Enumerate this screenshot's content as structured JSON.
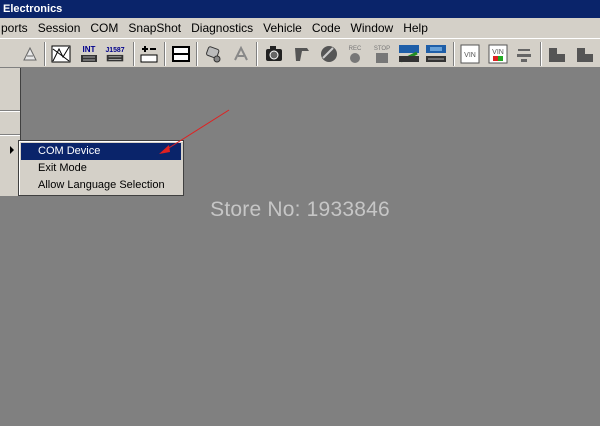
{
  "window": {
    "title": "Electronics"
  },
  "menubar": {
    "items": [
      {
        "label": "ports",
        "icon": ""
      },
      {
        "label": "Session"
      },
      {
        "label": "COM"
      },
      {
        "label": "SnapShot"
      },
      {
        "label": "Diagnostics"
      },
      {
        "label": "Vehicle"
      },
      {
        "label": "Code"
      },
      {
        "label": "Window"
      },
      {
        "label": "Help"
      }
    ]
  },
  "toolbar": {
    "labels": {
      "int": "INT",
      "j1587": "J1587",
      "rec": "REC",
      "stop": "STOP",
      "vin": "VIN"
    }
  },
  "popup_menu": {
    "items": [
      {
        "label": "COM Device",
        "selected": true
      },
      {
        "label": "Exit Mode",
        "selected": false
      },
      {
        "label": "Allow Language Selection",
        "selected": false
      }
    ]
  },
  "watermark": {
    "text": "Store No: 1933846"
  },
  "colors": {
    "titlebar": "#0a246a",
    "chrome": "#d4d0c8",
    "workspace": "#808080",
    "selection": "#0a246a",
    "annotation_arrow": "#e02020"
  }
}
